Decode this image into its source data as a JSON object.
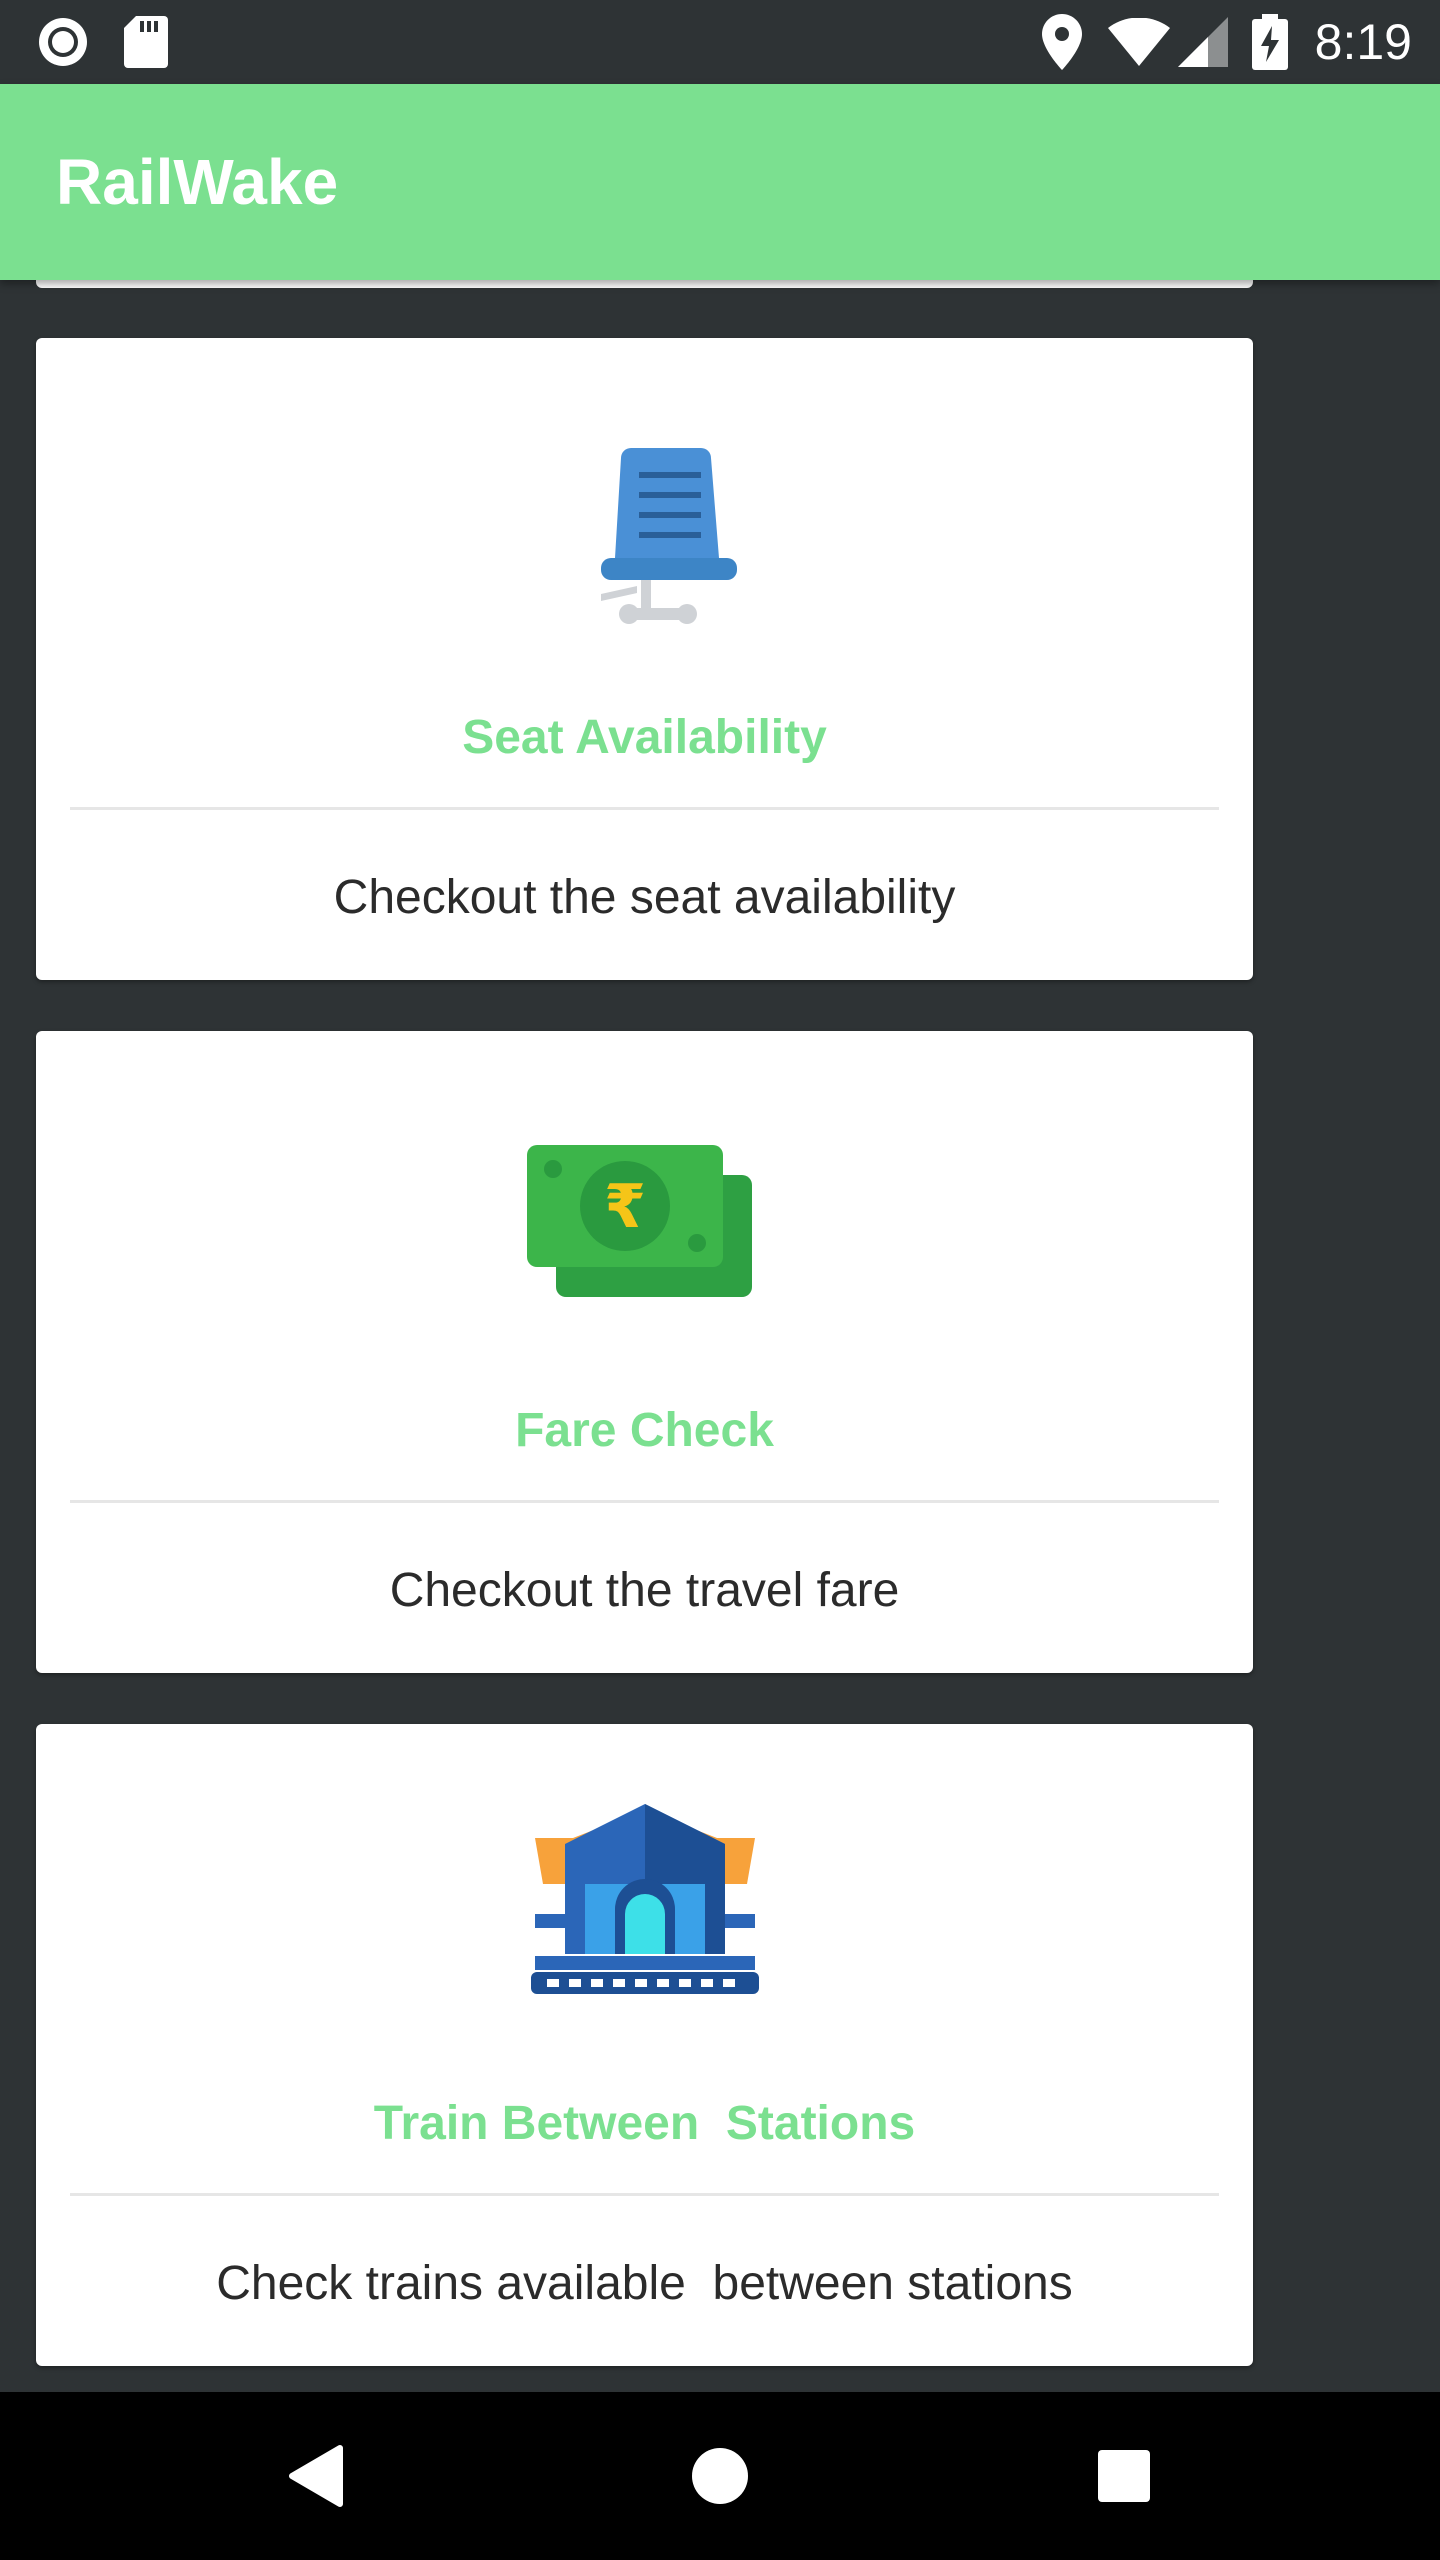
{
  "status_bar": {
    "time": "8:19",
    "icons": [
      "record-icon",
      "sd-card-icon",
      "location-icon",
      "wifi-icon",
      "signal-icon",
      "battery-charging-icon"
    ]
  },
  "app_bar": {
    "title": "RailWake"
  },
  "cards": [
    {
      "icon": "seat-icon",
      "title": "Seat Availability",
      "description": "Checkout the seat availability"
    },
    {
      "icon": "money-icon",
      "title": "Fare Check",
      "description": "Checkout the travel fare"
    },
    {
      "icon": "station-icon",
      "title": "Train Between  Stations",
      "description": "Check trains available  between stations"
    }
  ],
  "nav_bar": {
    "buttons": [
      "back-icon",
      "home-icon",
      "recents-icon"
    ]
  },
  "colors": {
    "accent": "#7be090",
    "background": "#2e3335",
    "card": "#ffffff",
    "text": "#2b2b2b"
  }
}
